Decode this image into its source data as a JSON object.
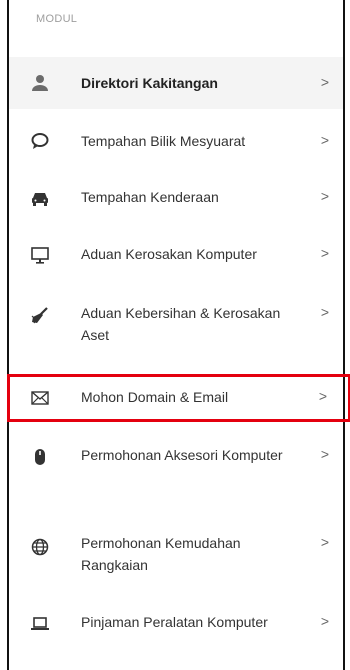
{
  "section": {
    "title": "MODUL"
  },
  "menu": {
    "items": [
      {
        "label": "Direktori Kakitangan",
        "icon": "user-icon",
        "chevron": ">"
      },
      {
        "label": "Tempahan Bilik Mesyuarat",
        "icon": "speech-bubble-icon",
        "chevron": ">"
      },
      {
        "label": "Tempahan Kenderaan",
        "icon": "car-icon",
        "chevron": ">"
      },
      {
        "label": "Aduan Kerosakan Komputer",
        "icon": "monitor-icon",
        "chevron": ">"
      },
      {
        "label": "Aduan Kebersihan & Kerosakan Aset",
        "icon": "broom-icon",
        "chevron": ">"
      },
      {
        "label": "Mohon Domain & Email",
        "icon": "envelope-icon",
        "chevron": ">"
      },
      {
        "label": "Permohonan Aksesori Komputer",
        "icon": "mouse-icon",
        "chevron": ">"
      },
      {
        "label": "Permohonan Kemudahan Rangkaian",
        "icon": "globe-icon",
        "chevron": ">"
      },
      {
        "label": "Pinjaman Peralatan Komputer",
        "icon": "laptop-icon",
        "chevron": ">"
      }
    ]
  },
  "colors": {
    "highlight_border": "#e4000f",
    "active_bg": "#f4f4f4",
    "text": "#333333"
  }
}
